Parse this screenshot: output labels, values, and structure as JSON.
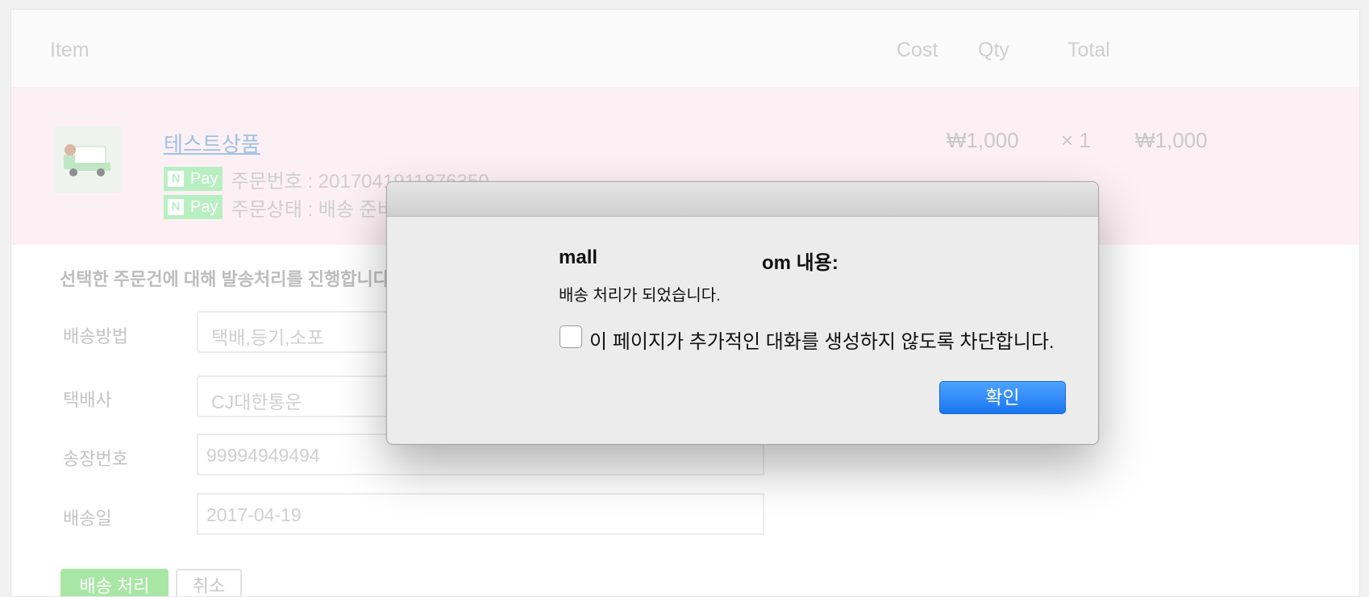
{
  "table": {
    "headers": {
      "item": "Item",
      "cost": "Cost",
      "qty": "Qty",
      "total": "Total"
    },
    "row": {
      "thumbnail_icon": "delivery-truck-icon",
      "product_name": "테스트상품",
      "pay_badge": {
        "n": "N",
        "label": "Pay"
      },
      "order_number": "주문번호 : 2017041911876350",
      "order_status": "주문상태 : 배송 준비",
      "cost": "₩1,000",
      "qty": "× 1",
      "total": "₩1,000"
    }
  },
  "form": {
    "notice": "선택한 주문건에 대해 발송처리를 진행합니다",
    "fields": [
      {
        "label": "배송방법",
        "value": "택배,등기,소포"
      },
      {
        "label": "택배사",
        "value": "CJ대한통운"
      },
      {
        "label": "송장번호",
        "value": "99994949494"
      },
      {
        "label": "배송일",
        "value": "2017-04-19"
      }
    ],
    "ship_button": "배송 처리",
    "cancel_button": "취소"
  },
  "dialog": {
    "title_left": "mall",
    "title_right": "om 내용:",
    "message": "배송 처리가 되었습니다.",
    "checkbox_label": "이 페이지가 추가적인 대화를 생성하지 않도록 차단합니다.",
    "checkbox_checked": false,
    "ok_button": "확인"
  },
  "colors": {
    "accent_blue": "#1a76f0",
    "naver_green": "#b8efc2",
    "ship_button_green": "#a8e6a6"
  }
}
